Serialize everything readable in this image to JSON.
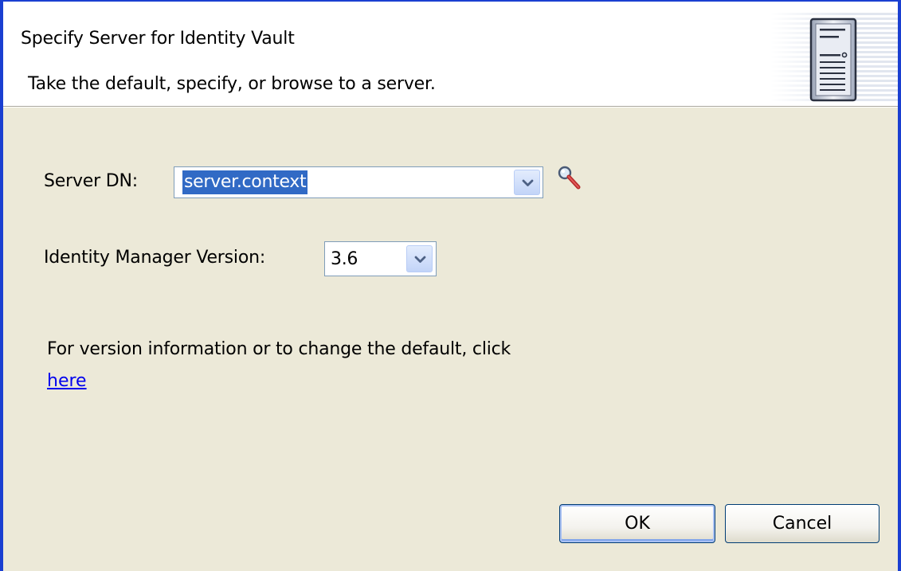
{
  "header": {
    "title": "Specify Server for Identity Vault",
    "subtitle": "Take the default, specify, or browse to a server.",
    "icon": "server-icon"
  },
  "server_dn": {
    "label": "Server DN:",
    "value": "server.context",
    "dropdown_icon": "chevron-down-icon",
    "browse_icon": "magnifier-icon"
  },
  "idm_version": {
    "label": "Identity Manager Version:",
    "value": "3.6",
    "dropdown_icon": "chevron-down-icon"
  },
  "info": {
    "text": "For version information or to change the default, click",
    "link_label": "here"
  },
  "buttons": {
    "ok_label": "OK",
    "cancel_label": "Cancel"
  },
  "colors": {
    "window_border": "#1a3fd1",
    "dialog_background": "#ece9d8",
    "selection": "#316ac5",
    "link": "#0000ee"
  }
}
